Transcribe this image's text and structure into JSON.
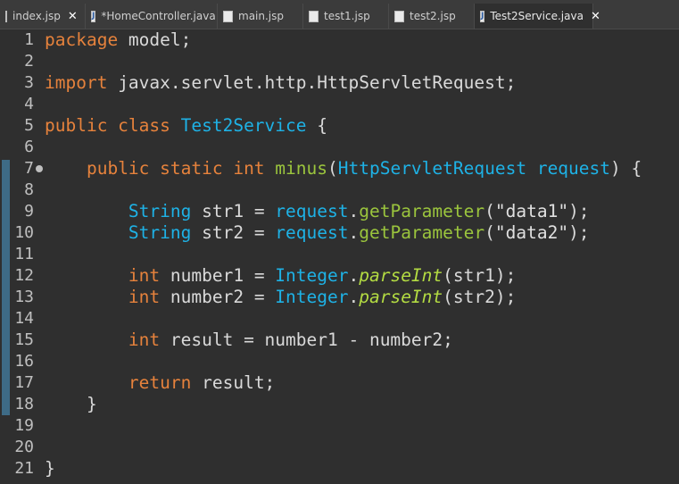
{
  "tabs": [
    {
      "label": "index.jsp",
      "closable": true,
      "active": false,
      "icon": "jsp-file-icon",
      "icon_glyph": ""
    },
    {
      "label": "*HomeController.java",
      "closable": false,
      "active": false,
      "icon": "java-file-icon",
      "icon_glyph": "J"
    },
    {
      "label": "main.jsp",
      "closable": false,
      "active": false,
      "icon": "jsp-file-icon",
      "icon_glyph": ""
    },
    {
      "label": "test1.jsp",
      "closable": false,
      "active": false,
      "icon": "jsp-file-icon",
      "icon_glyph": ""
    },
    {
      "label": "test2.jsp",
      "closable": false,
      "active": false,
      "icon": "jsp-file-icon",
      "icon_glyph": ""
    },
    {
      "label": "Test2Service.java",
      "closable": true,
      "active": true,
      "icon": "java-file-icon",
      "icon_glyph": "J"
    }
  ],
  "close_glyph": "✕",
  "code": [
    {
      "n": "1",
      "tokens": [
        [
          "kw",
          "package"
        ],
        [
          "pl",
          " model;"
        ]
      ]
    },
    {
      "n": "2",
      "tokens": []
    },
    {
      "n": "3",
      "tokens": [
        [
          "kw",
          "import"
        ],
        [
          "pl",
          " javax.servlet.http.HttpServletRequest;"
        ]
      ]
    },
    {
      "n": "4",
      "tokens": []
    },
    {
      "n": "5",
      "tokens": [
        [
          "kw",
          "public class "
        ],
        [
          "cls",
          "Test2Service"
        ],
        [
          "pl",
          " {"
        ]
      ]
    },
    {
      "n": "6",
      "tokens": []
    },
    {
      "n": "7",
      "tokens": [
        [
          "pl",
          "    "
        ],
        [
          "kw",
          "public static int "
        ],
        [
          "mth",
          "minus"
        ],
        [
          "pl",
          "("
        ],
        [
          "cls",
          "HttpServletRequest"
        ],
        [
          "pl",
          " "
        ],
        [
          "cls",
          "request"
        ],
        [
          "pl",
          ") {"
        ]
      ]
    },
    {
      "n": "8",
      "tokens": []
    },
    {
      "n": "9",
      "tokens": [
        [
          "pl",
          "        "
        ],
        [
          "cls",
          "String"
        ],
        [
          "pl",
          " str1 = "
        ],
        [
          "cls",
          "request"
        ],
        [
          "pl",
          "."
        ],
        [
          "mth",
          "getParameter"
        ],
        [
          "pl",
          "("
        ],
        [
          "str",
          "\"data1\""
        ],
        [
          "pl",
          ");"
        ]
      ]
    },
    {
      "n": "10",
      "tokens": [
        [
          "pl",
          "        "
        ],
        [
          "cls",
          "String"
        ],
        [
          "pl",
          " str2 = "
        ],
        [
          "cls",
          "request"
        ],
        [
          "pl",
          "."
        ],
        [
          "mth",
          "getParameter"
        ],
        [
          "pl",
          "("
        ],
        [
          "str",
          "\"data2\""
        ],
        [
          "pl",
          ");"
        ]
      ]
    },
    {
      "n": "11",
      "tokens": []
    },
    {
      "n": "12",
      "tokens": [
        [
          "pl",
          "        "
        ],
        [
          "kw",
          "int"
        ],
        [
          "pl",
          " number1 = "
        ],
        [
          "cls",
          "Integer"
        ],
        [
          "pl",
          "."
        ],
        [
          "ital",
          "parseInt"
        ],
        [
          "pl",
          "(str1);"
        ]
      ]
    },
    {
      "n": "13",
      "tokens": [
        [
          "pl",
          "        "
        ],
        [
          "kw",
          "int"
        ],
        [
          "pl",
          " number2 = "
        ],
        [
          "cls",
          "Integer"
        ],
        [
          "pl",
          "."
        ],
        [
          "ital",
          "parseInt"
        ],
        [
          "pl",
          "(str2);"
        ]
      ]
    },
    {
      "n": "14",
      "tokens": []
    },
    {
      "n": "15",
      "tokens": [
        [
          "pl",
          "        "
        ],
        [
          "kw",
          "int"
        ],
        [
          "pl",
          " result = number1 - number2;"
        ]
      ]
    },
    {
      "n": "16",
      "tokens": []
    },
    {
      "n": "17",
      "tokens": [
        [
          "pl",
          "        "
        ],
        [
          "kw",
          "return"
        ],
        [
          "pl",
          " result;"
        ]
      ]
    },
    {
      "n": "18",
      "tokens": [
        [
          "pl",
          "    }"
        ]
      ]
    },
    {
      "n": "19",
      "tokens": []
    },
    {
      "n": "20",
      "tokens": []
    },
    {
      "n": "21",
      "tokens": [
        [
          "pl",
          "}"
        ]
      ]
    }
  ],
  "colors": {
    "keyword": "#e6823c",
    "type": "#1eb2e6",
    "method": "#9bc53d",
    "plain": "#d9d9d9",
    "background": "#2f2f2f",
    "change_marker": "#3e6b86"
  }
}
